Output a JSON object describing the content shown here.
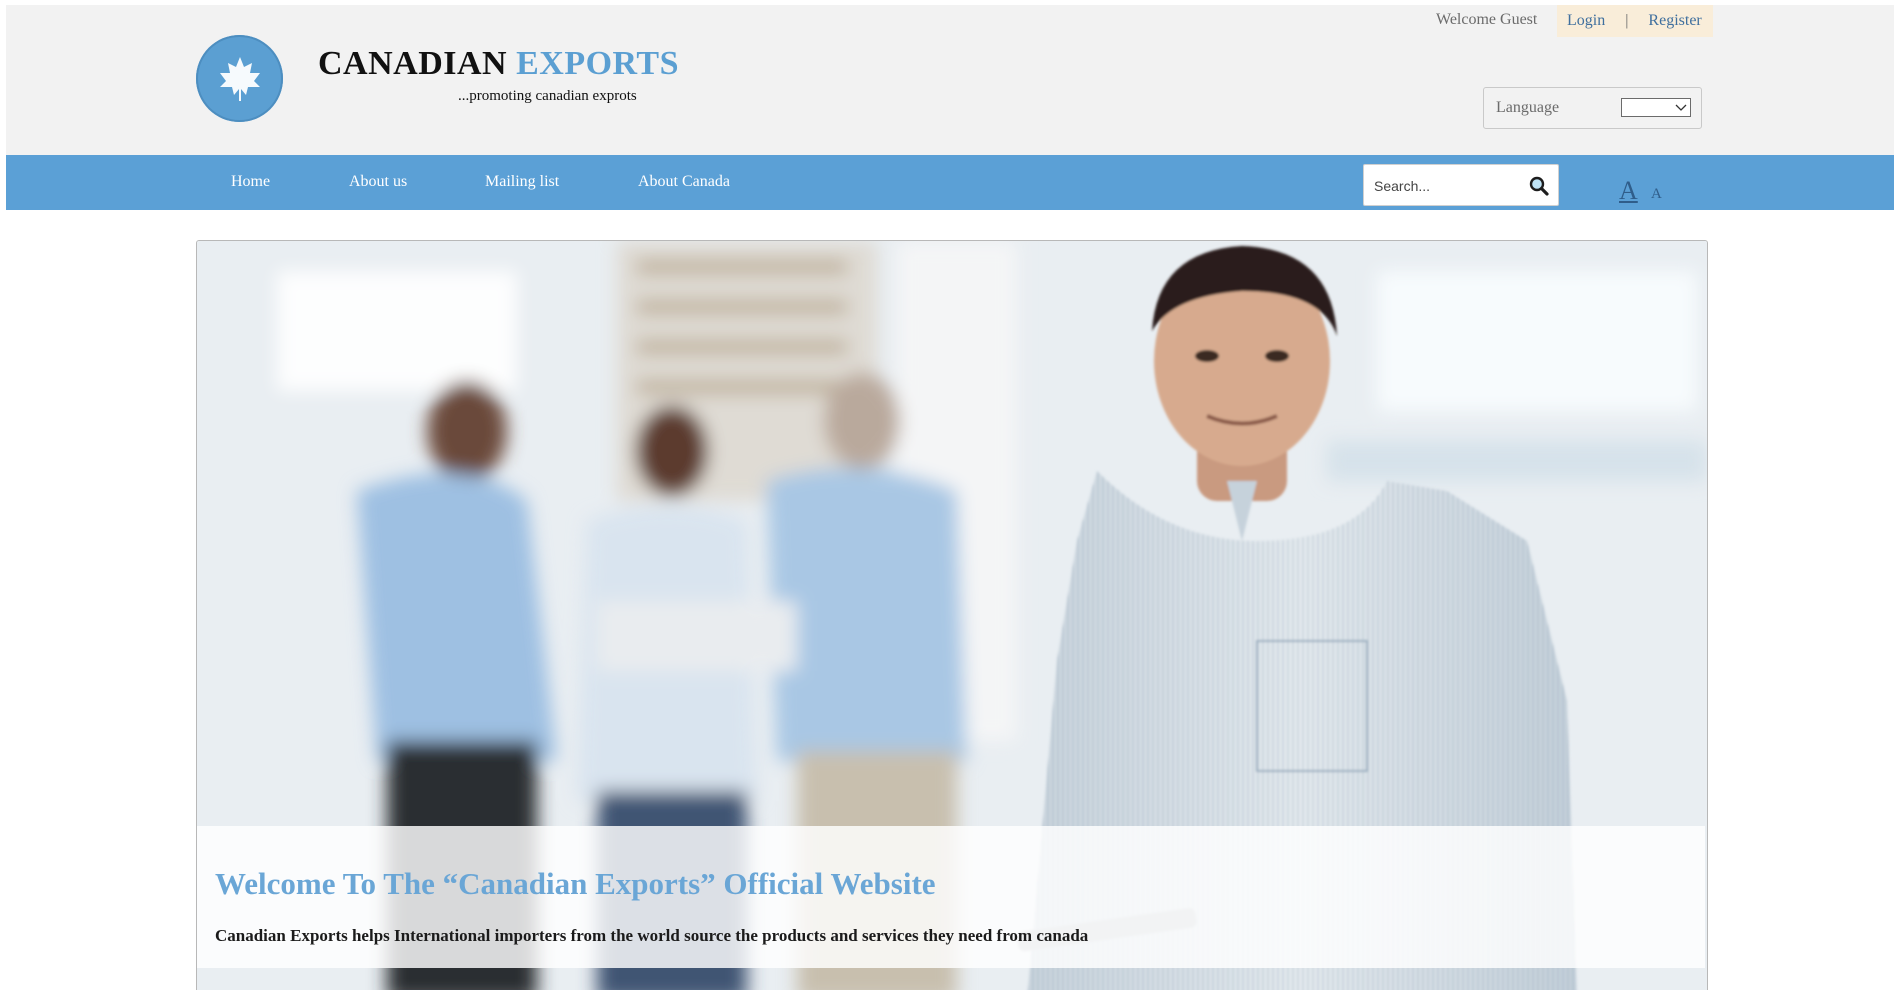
{
  "brand": {
    "name_main": "CANADIAN",
    "name_accent": "EXPORTS",
    "tagline": "...promoting canadian exprots"
  },
  "user_bar": {
    "welcome": "Welcome Guest",
    "login": "Login",
    "separator": "|",
    "register": "Register"
  },
  "language": {
    "label": "Language",
    "selected": ""
  },
  "nav": {
    "items": [
      "Home",
      "About us",
      "Mailing list",
      "About Canada"
    ]
  },
  "search": {
    "placeholder": "Search...",
    "value": ""
  },
  "font_size": {
    "large": "A",
    "small": "A"
  },
  "hero": {
    "title": "Welcome To The “Canadian Exports” Official Website",
    "description": "Canadian Exports helps International importers from the world source the products and services they need from canada"
  },
  "colors": {
    "brand_blue": "#5ba0d6",
    "header_bg": "#f2f2f2",
    "auth_bg": "#f9edd9",
    "title_blue": "#6aa6d6"
  }
}
